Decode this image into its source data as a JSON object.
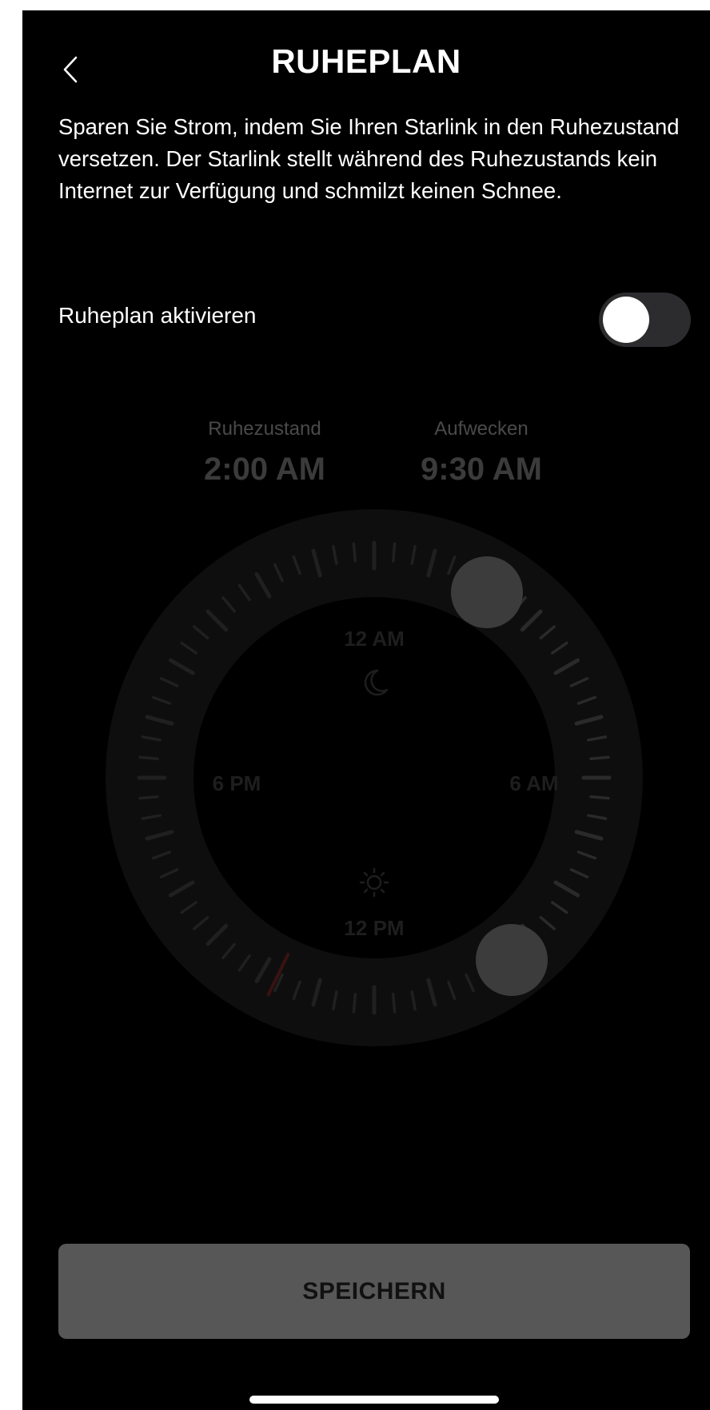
{
  "header": {
    "title": "RUHEPLAN",
    "back_icon": "chevron-left-icon"
  },
  "description": "Sparen Sie Strom, indem Sie Ihren Starlink in den Ruhezustand versetzen. Der Starlink stellt während des Ruhezustands kein Internet zur Verfügung und schmilzt keinen Schnee.",
  "toggle": {
    "label": "Ruheplan aktivieren",
    "enabled": false
  },
  "schedule": {
    "sleep_caption": "Ruhezustand",
    "sleep_time": "2:00 AM",
    "wake_caption": "Aufwecken",
    "wake_time": "9:30 AM"
  },
  "dial": {
    "label_top": "12 AM",
    "label_right": "6 AM",
    "label_bottom": "12 PM",
    "label_left": "6 PM",
    "night_icon": "moon-icon",
    "day_icon": "sun-icon",
    "current_time_marker_color": "#3a1212"
  },
  "save_button": {
    "label": "SPEICHERN"
  },
  "colors": {
    "background": "#000000",
    "toggle_track": "#2c2c2e",
    "button": "#575757",
    "dial_ring": "#0e0e0e"
  }
}
